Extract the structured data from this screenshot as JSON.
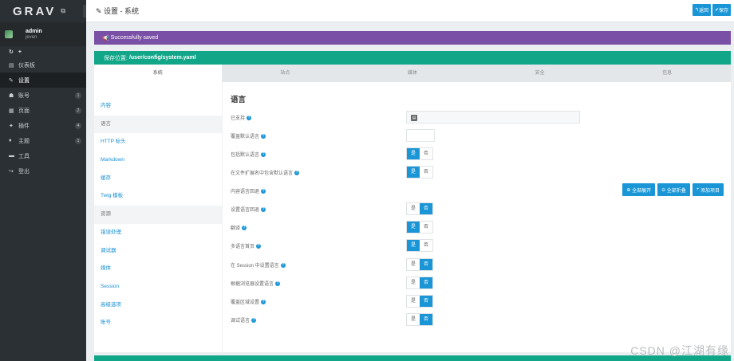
{
  "brand": {
    "logo": "GRAV",
    "external_icon": "⧉"
  },
  "user": {
    "name": "admin",
    "sub": "jeven"
  },
  "mini_actions": [
    "↻",
    "+"
  ],
  "nav": [
    {
      "icon": "dashboard-icon",
      "glyph": "▤",
      "label": "仪表板",
      "badge": ""
    },
    {
      "icon": "wrench-icon",
      "glyph": "✎",
      "label": "设置",
      "badge": ""
    },
    {
      "icon": "users-icon",
      "glyph": "☗",
      "label": "账号",
      "badge": "1"
    },
    {
      "icon": "page-icon",
      "glyph": "▦",
      "label": "页面",
      "badge": "2"
    },
    {
      "icon": "plugin-icon",
      "glyph": "✦",
      "label": "插件",
      "badge": "4"
    },
    {
      "icon": "theme-icon",
      "glyph": "♦",
      "label": "主题",
      "badge": "1"
    },
    {
      "icon": "tools-icon",
      "glyph": "▬",
      "label": "工具",
      "badge": ""
    },
    {
      "icon": "logout-icon",
      "glyph": "↪",
      "label": "登出",
      "badge": ""
    }
  ],
  "topbar": {
    "title": "设置 - 系统",
    "back_label": "返回",
    "save_label": "保存"
  },
  "alert": {
    "text": "Successfully saved"
  },
  "path": {
    "prefix": "保存位置:",
    "value": "/user/config/system.yaml"
  },
  "tabs": [
    "系统",
    "站点",
    "媒体",
    "安全",
    "信息"
  ],
  "subnav": [
    "内容",
    "语言",
    "HTTP 标头",
    "Markdown",
    "缓存",
    "Twig 模板",
    "资源",
    "错误处理",
    "调试器",
    "媒体",
    "Session",
    "高级选项",
    "账号"
  ],
  "section_title": "语言",
  "rows": [
    {
      "label": "已支持",
      "type": "select",
      "chip": "▤"
    },
    {
      "label": "覆盖默认语言",
      "type": "box"
    },
    {
      "label": "包括默认语言",
      "type": "toggle",
      "on": "yes"
    },
    {
      "label": "在文件扩展名中包含默认语言",
      "type": "toggle",
      "on": "yes"
    },
    {
      "label": "内容语言回退",
      "type": "buttons"
    },
    {
      "label": "设置语言回退",
      "type": "toggle",
      "on": "no"
    },
    {
      "label": "翻译",
      "type": "toggle",
      "on": "yes"
    },
    {
      "label": "多语言首页",
      "type": "toggle",
      "on": "yes"
    },
    {
      "label": "在 Session 中设置语言",
      "type": "toggle",
      "on": "no"
    },
    {
      "label": "根据浏览器设置语言",
      "type": "toggle",
      "on": "no"
    },
    {
      "label": "覆盖区域设置",
      "type": "toggle",
      "on": "no"
    },
    {
      "label": "调试语言",
      "type": "toggle",
      "on": "no"
    }
  ],
  "toggle_labels": {
    "yes": "是",
    "no": "否"
  },
  "fallback_buttons": [
    "全部展开",
    "全部折叠",
    "添加项目"
  ],
  "watermark": "CSDN @江湖有缘",
  "colors": {
    "sidebar": "#2b3034",
    "accent": "#1a96d6",
    "alert": "#7a4fa6",
    "teal": "#11a688"
  }
}
